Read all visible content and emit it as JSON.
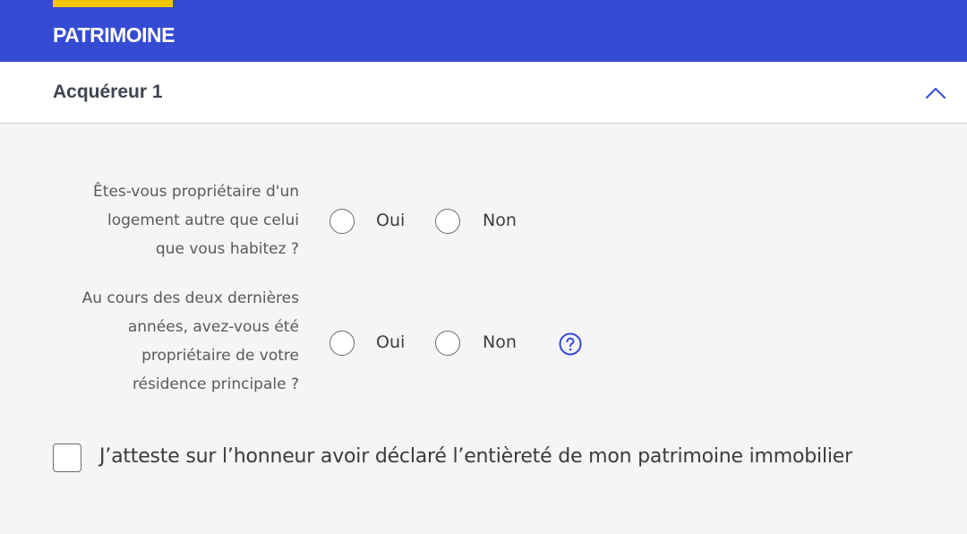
{
  "colors": {
    "brand": "#354bd3",
    "accent": "#f5c400",
    "help_icon": "#354bd3"
  },
  "header": {
    "title": "PATRIMOINE"
  },
  "section": {
    "title": "Acquéreur 1",
    "toggle_icon": "chevron-up-icon"
  },
  "questions": [
    {
      "label_lines": [
        "Êtes-vous propriétaire d'un",
        "logement autre que celui",
        "que vous habitez ?"
      ],
      "options": [
        "Oui",
        "Non"
      ]
    },
    {
      "label_lines": [
        "Au cours des deux dernières",
        "années, avez-vous été",
        "propriétaire de votre",
        "résidence principale ?"
      ],
      "options": [
        "Oui",
        "Non"
      ],
      "help_icon": "question-circle-icon"
    }
  ],
  "attestation": {
    "label": "J’atteste sur l’honneur avoir déclaré l’entièreté de mon patrimoine immobilier",
    "checked": false
  }
}
